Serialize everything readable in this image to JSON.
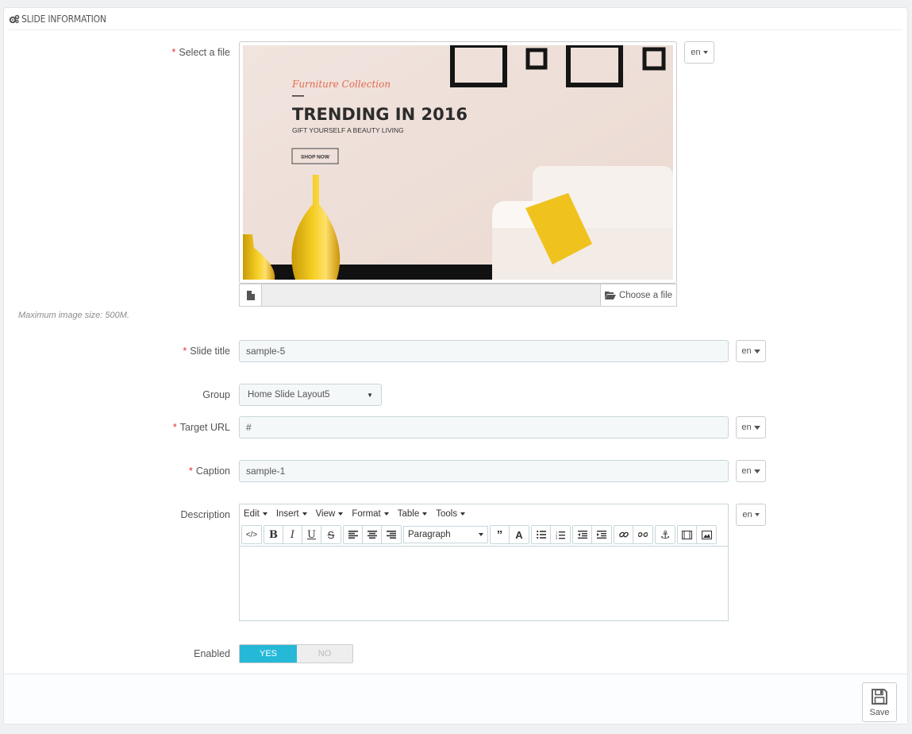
{
  "panel": {
    "title": "Slide information"
  },
  "fields": {
    "file": {
      "label": "Select a file",
      "lang": "en",
      "choose_label": "Choose a file",
      "hint": "Maximum image size: 500M."
    },
    "slide_title": {
      "label": "Slide title",
      "value": "sample-5",
      "lang": "en"
    },
    "group": {
      "label": "Group",
      "value": "Home Slide Layout5"
    },
    "target_url": {
      "label": "Target URL",
      "value": "#",
      "lang": "en"
    },
    "caption": {
      "label": "Caption",
      "value": "sample-1",
      "lang": "en"
    },
    "description": {
      "label": "Description",
      "lang": "en",
      "menu": [
        "Edit",
        "Insert",
        "View",
        "Format",
        "Table",
        "Tools"
      ],
      "block_format": "Paragraph"
    },
    "enabled": {
      "label": "Enabled",
      "yes": "YES",
      "no": "NO"
    }
  },
  "preview_image": {
    "script_title": "Furniture Collection",
    "headline": "TRENDING IN 2016",
    "subline": "GIFT YOURSELF A BEAUTY LIVING",
    "cta": "SHOP NOW"
  },
  "footer": {
    "save_label": "Save"
  },
  "colors": {
    "accent": "#25b9d7",
    "required": "#e32e2e"
  }
}
